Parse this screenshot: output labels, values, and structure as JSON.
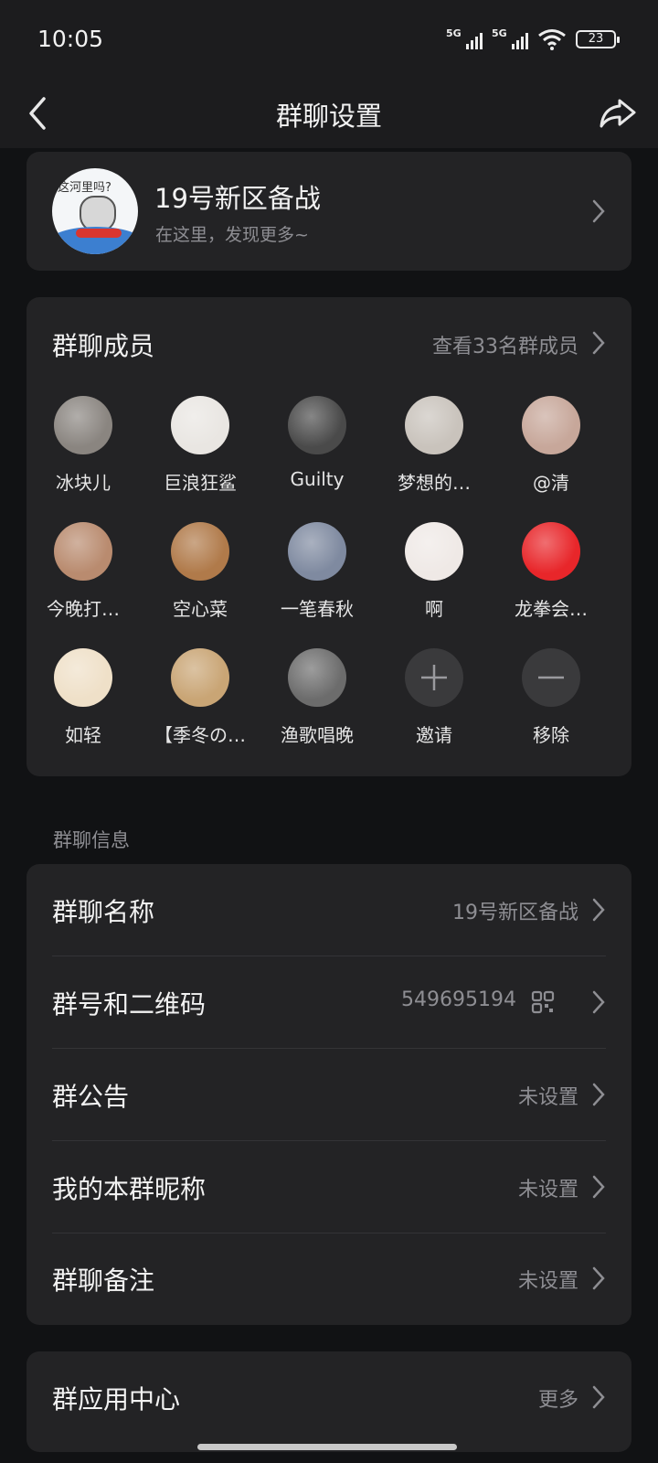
{
  "status_bar": {
    "time": "10:05",
    "network1": "5G",
    "network2": "5G",
    "battery": "23"
  },
  "nav": {
    "title": "群聊设置"
  },
  "group": {
    "name": "19号新区备战",
    "subtitle": "在这里，发现更多~",
    "avatar_caption": "这河里吗?"
  },
  "members": {
    "title": "群聊成员",
    "view_all": "查看33名群成员",
    "list": [
      {
        "name": "冰块儿",
        "color": "#8a8580"
      },
      {
        "name": "巨浪狂鲨",
        "color": "#e9e6e2"
      },
      {
        "name": "Guilty",
        "color": "#4a4a4a"
      },
      {
        "name": "梦想的…",
        "color": "#c9c3bc"
      },
      {
        "name": "@清",
        "color": "#c7a79a"
      },
      {
        "name": "今晚打…",
        "color": "#b98b6f"
      },
      {
        "name": "空心菜",
        "color": "#b07a4a"
      },
      {
        "name": "一笔春秋",
        "color": "#7f8aa0"
      },
      {
        "name": "啊",
        "color": "#efe9e6"
      },
      {
        "name": "龙拳会…",
        "color": "#e8262a"
      },
      {
        "name": "如轻",
        "color": "#efe0c8"
      },
      {
        "name": "【季冬の…",
        "color": "#c9a575"
      },
      {
        "name": "渔歌唱晚",
        "color": "#6c6c6c"
      }
    ],
    "invite_label": "邀请",
    "remove_label": "移除"
  },
  "info": {
    "section_label": "群聊信息",
    "rows": [
      {
        "label": "群聊名称",
        "value": "19号新区备战"
      },
      {
        "label": "群号和二维码",
        "value": "549695194"
      },
      {
        "label": "群公告",
        "value": "未设置"
      },
      {
        "label": "我的本群昵称",
        "value": "未设置"
      },
      {
        "label": "群聊备注",
        "value": "未设置"
      }
    ]
  },
  "app_center": {
    "label": "群应用中心",
    "value": "更多"
  }
}
